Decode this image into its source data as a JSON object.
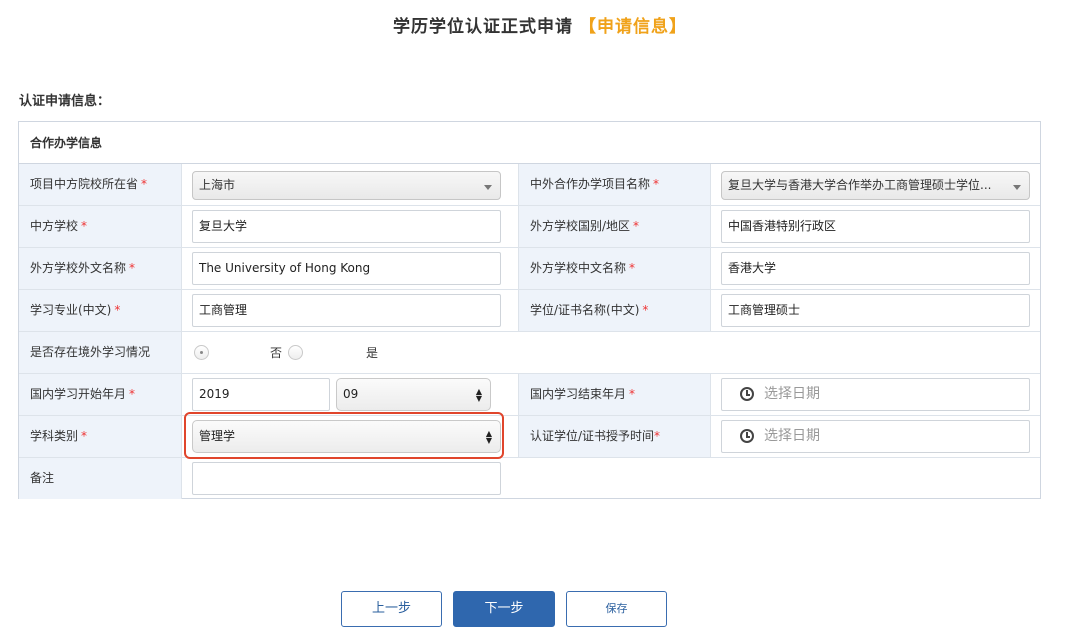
{
  "header": {
    "title": "学历学位认证正式申请",
    "highlight": "【申请信息】"
  },
  "section_label": "认证申请信息：",
  "box_title": "合作办学信息",
  "required_mark": "*",
  "rows": {
    "r1": {
      "left_label": "项目中方院校所在省",
      "left_value": "上海市",
      "right_label": "中外合作办学项目名称",
      "right_value": "复旦大学与香港大学合作举办工商管理硕士学位..."
    },
    "r2": {
      "left_label": "中方学校",
      "left_value": "复旦大学",
      "right_label": "外方学校国别/地区",
      "right_value": "中国香港特别行政区"
    },
    "r3": {
      "left_label": "外方学校外文名称",
      "left_value": "The University of Hong Kong",
      "right_label": "外方学校中文名称",
      "right_value": "香港大学"
    },
    "r4": {
      "left_label": "学习专业(中文)",
      "left_value": "工商管理",
      "right_label": "学位/证书名称(中文)",
      "right_value": "工商管理硕士"
    },
    "r5": {
      "label": "是否存在境外学习情况",
      "option_no": "否",
      "option_yes": "是"
    },
    "r6": {
      "left_label": "国内学习开始年月",
      "year": "2019",
      "month": "09",
      "right_label": "国内学习结束年月",
      "date_placeholder": "选择日期"
    },
    "r7": {
      "left_label": "学科类别",
      "left_value": "管理学",
      "right_label": "认证学位/证书授予时间",
      "date_placeholder": "选择日期"
    },
    "r8": {
      "label": "备注",
      "value": ""
    }
  },
  "buttons": {
    "prev": "上一步",
    "next": "下一步",
    "save": "保存"
  }
}
